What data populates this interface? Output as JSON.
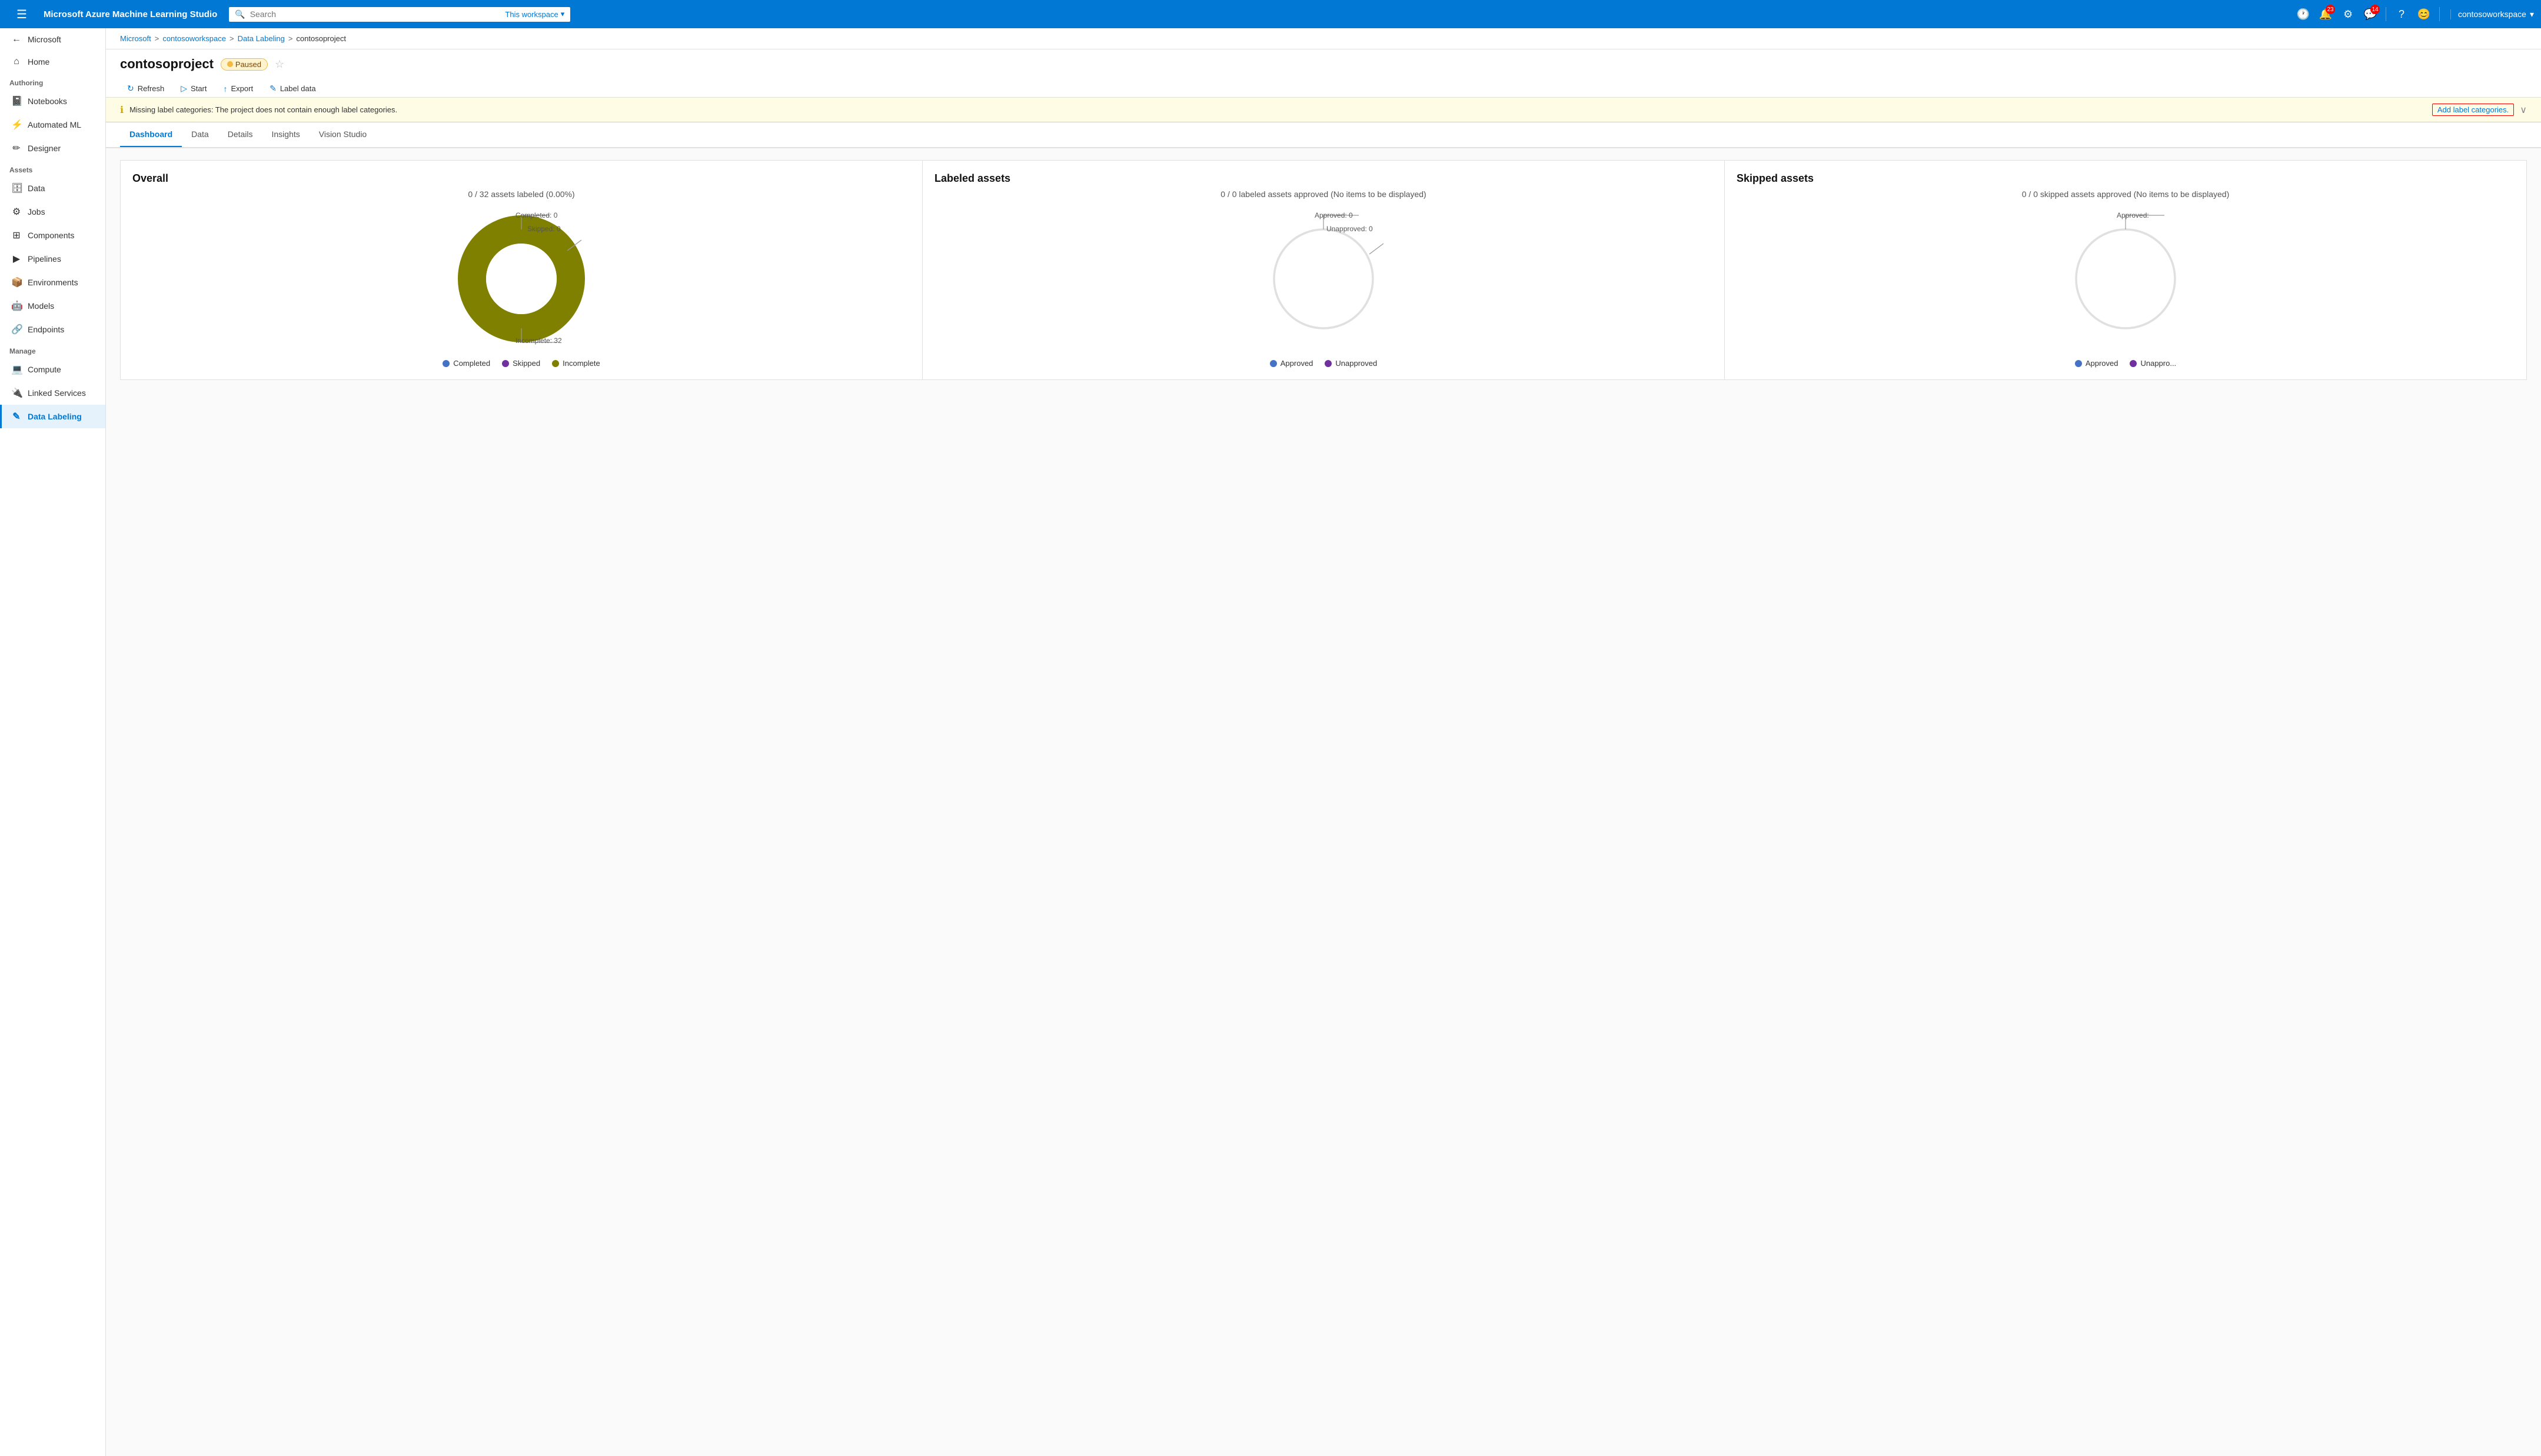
{
  "app": {
    "brand": "Microsoft Azure Machine Learning Studio"
  },
  "topnav": {
    "search_placeholder": "Search",
    "search_workspace": "This workspace",
    "notifications_count": "23",
    "feedback_count": "14",
    "username": "contosoworkspace"
  },
  "breadcrumb": {
    "items": [
      {
        "label": "Microsoft",
        "link": true
      },
      {
        "label": "contosoworkspace",
        "link": true
      },
      {
        "label": "Data Labeling",
        "link": true
      },
      {
        "label": "contosoproject",
        "link": false
      }
    ]
  },
  "page": {
    "title": "contosoproject",
    "status": "Paused"
  },
  "toolbar": {
    "refresh": "Refresh",
    "start": "Start",
    "export": "Export",
    "label_data": "Label data"
  },
  "tabs": [
    {
      "label": "Dashboard",
      "active": true
    },
    {
      "label": "Data"
    },
    {
      "label": "Details"
    },
    {
      "label": "Insights"
    },
    {
      "label": "Vision Studio"
    }
  ],
  "warning": {
    "text": "Missing label categories: The project does not contain enough label categories.",
    "link_label": "Add label categories.",
    "icon": "ℹ"
  },
  "overall_chart": {
    "title": "Overall",
    "subtitle": "0 / 32 assets labeled (0.00%)",
    "label_completed": "Completed: 0",
    "label_skipped": "Skipped: 0",
    "label_incomplete": "Incomplete: 32",
    "legend": [
      {
        "label": "Completed",
        "color": "#4472c4"
      },
      {
        "label": "Skipped",
        "color": "#7030a0"
      },
      {
        "label": "Incomplete",
        "color": "#808000"
      }
    ],
    "donut_color": "#808000",
    "donut_bg": "#e0e0e0"
  },
  "labeled_assets_chart": {
    "title": "Labeled assets",
    "subtitle": "0 / 0 labeled assets approved (No items to be displayed)",
    "label_approved": "Approved: 0",
    "label_unapproved": "Unapproved: 0",
    "legend": [
      {
        "label": "Approved",
        "color": "#4472c4"
      },
      {
        "label": "Unapproved",
        "color": "#7030a0"
      }
    ]
  },
  "skipped_assets_chart": {
    "title": "Skipped assets",
    "subtitle": "0 / 0 skipped assets approved (No items to be displayed)",
    "label_approved": "Approved:",
    "legend": [
      {
        "label": "Approved",
        "color": "#4472c4"
      },
      {
        "label": "Unappro...",
        "color": "#7030a0"
      }
    ]
  },
  "sidebar": {
    "menu_sections": [
      {
        "label": "",
        "items": [
          {
            "label": "Microsoft",
            "icon": "←",
            "indent": false
          },
          {
            "label": "Home",
            "icon": "🏠"
          },
          {
            "label": "",
            "section_label": "Authoring"
          }
        ]
      }
    ],
    "items": [
      {
        "id": "microsoft",
        "label": "Microsoft",
        "icon": "←"
      },
      {
        "id": "home",
        "label": "Home",
        "icon": "🏠"
      },
      {
        "id": "notebooks",
        "label": "Notebooks",
        "icon": "📓",
        "section": "Authoring"
      },
      {
        "id": "automated-ml",
        "label": "Automated ML",
        "icon": "⚡"
      },
      {
        "id": "designer",
        "label": "Designer",
        "icon": "🎨"
      },
      {
        "id": "data",
        "label": "Data",
        "icon": "🗄",
        "section": "Assets"
      },
      {
        "id": "jobs",
        "label": "Jobs",
        "icon": "⚙"
      },
      {
        "id": "components",
        "label": "Components",
        "icon": "🧩"
      },
      {
        "id": "pipelines",
        "label": "Pipelines",
        "icon": "▶"
      },
      {
        "id": "environments",
        "label": "Environments",
        "icon": "📦"
      },
      {
        "id": "models",
        "label": "Models",
        "icon": "🤖"
      },
      {
        "id": "endpoints",
        "label": "Endpoints",
        "icon": "🔗"
      },
      {
        "id": "compute",
        "label": "Compute",
        "icon": "💻",
        "section": "Manage"
      },
      {
        "id": "linked-services",
        "label": "Linked Services",
        "icon": "🔌"
      },
      {
        "id": "data-labeling",
        "label": "Data Labeling",
        "icon": "🏷",
        "active": true
      }
    ]
  }
}
